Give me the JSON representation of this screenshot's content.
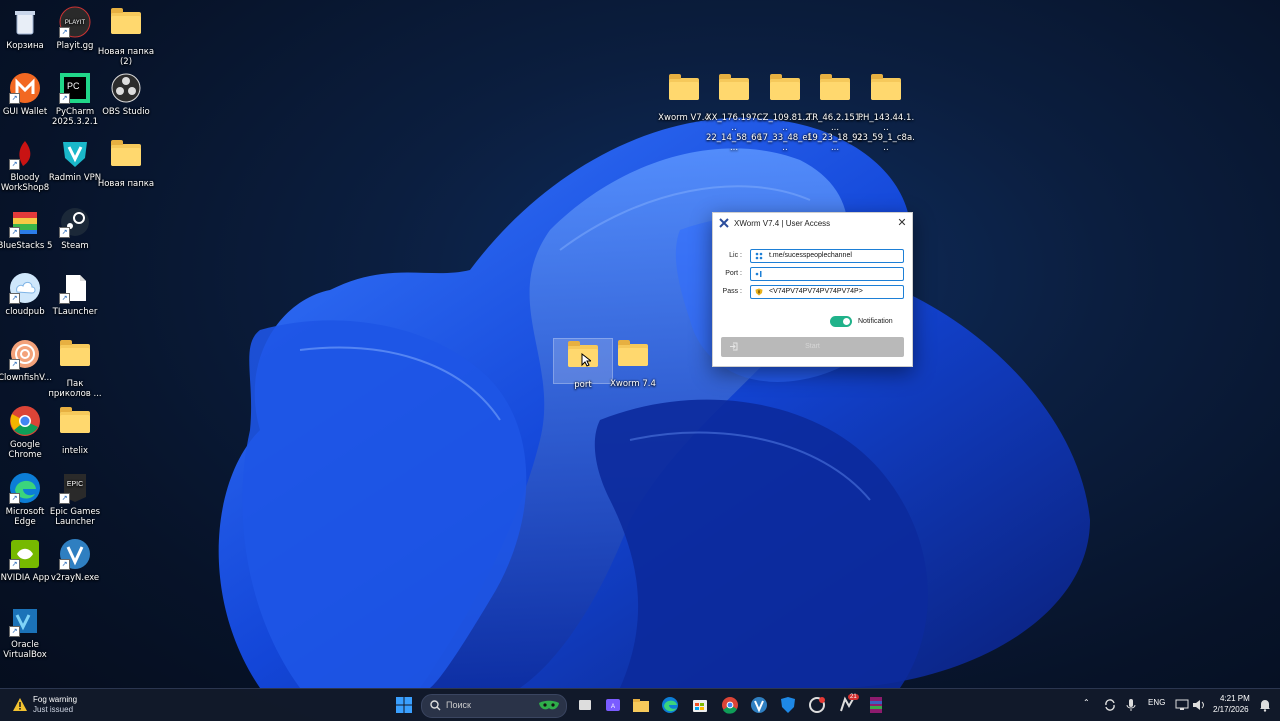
{
  "desktop": {
    "icons": [
      {
        "label": "Корзина"
      },
      {
        "label": "Playit.gg"
      },
      {
        "label": "Новая папка (2)"
      },
      {
        "label": "GUI Wallet"
      },
      {
        "label": "PyCharm 2025.3.2.1"
      },
      {
        "label": "OBS Studio"
      },
      {
        "label": "Bloody WorkShop8"
      },
      {
        "label": "Radmin VPN"
      },
      {
        "label": "Новая папка"
      },
      {
        "label": "BlueStacks 5"
      },
      {
        "label": "Steam"
      },
      {
        "label": "cloudpub"
      },
      {
        "label": "TLauncher"
      },
      {
        "label": "ClownfishV..."
      },
      {
        "label": "Пак приколов ..."
      },
      {
        "label": "Google Chrome"
      },
      {
        "label": "intelix"
      },
      {
        "label": "Microsoft Edge"
      },
      {
        "label": "Epic Games Launcher"
      },
      {
        "label": "NVIDIA App"
      },
      {
        "label": "v2rayN.exe"
      },
      {
        "label": "Oracle VirtualBox"
      },
      {
        "label": "Xworm V7.4"
      },
      {
        "label": "XX_176.197.... 22_14_58_66..."
      },
      {
        "label": "CZ_109.81.2... 17_33_48_ef..."
      },
      {
        "label": "TR_46.2.151.... 19_23_18_91..."
      },
      {
        "label": "PH_143.44.1... 23_59_1_c8a..."
      },
      {
        "label": "port"
      },
      {
        "label": "Xworm 7.4"
      }
    ]
  },
  "dialog": {
    "title": "XWorm V7.4 | User Access",
    "close": "✕",
    "lic_label": "Lic :",
    "lic_value": "t.me/sucesspeoplechannel",
    "port_label": "Port :",
    "port_value": "",
    "pass_label": "Pass :",
    "pass_value": "<V74PV74PV74PV74PV74P>",
    "notification_label": "Notification",
    "notification_on": true,
    "start_label": "Start"
  },
  "taskbar": {
    "weather_title": "Fog warning",
    "weather_sub": "Just issued",
    "search_placeholder": "Поиск",
    "lang": "ENG",
    "time": "4:21 PM",
    "date": "2/17/2026",
    "badge_count": "21"
  },
  "colors": {
    "accent": "#1d7fd6",
    "toggle_on": "#20b28a",
    "folder": "#f6c95b"
  }
}
